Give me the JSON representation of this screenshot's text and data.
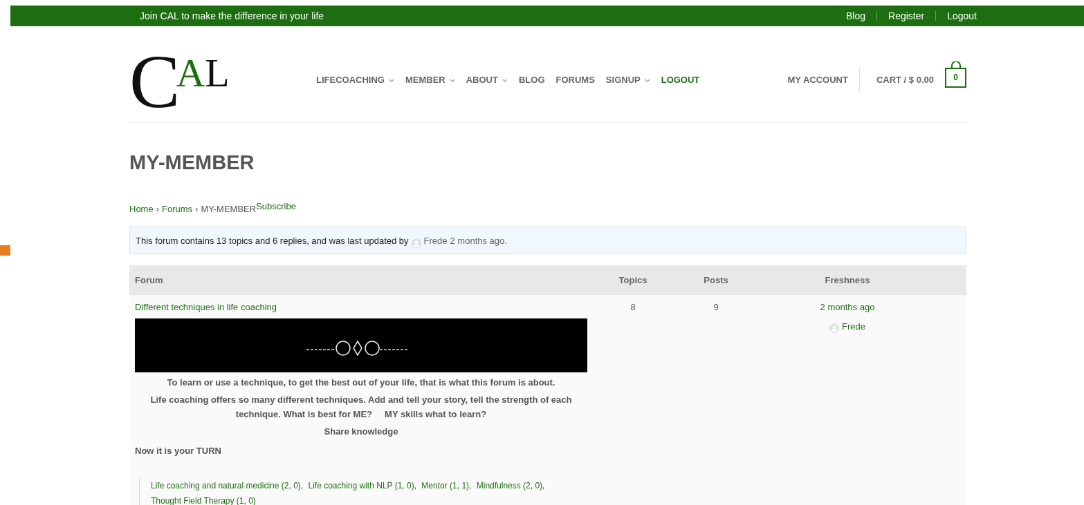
{
  "top_bar": {
    "tagline": "Join CAL to make the difference in your life",
    "links": [
      "Blog",
      "Register",
      "Logout"
    ]
  },
  "logo": {
    "letters": [
      {
        "text": "C",
        "color": "#111111"
      },
      {
        "text": "A",
        "color": "#1c6e10"
      },
      {
        "text": "L",
        "color": "#111111"
      }
    ]
  },
  "nav": [
    {
      "label": "LIFECOACHING",
      "dropdown": true,
      "selected": false
    },
    {
      "label": "MEMBER",
      "dropdown": true,
      "selected": false
    },
    {
      "label": "ABOUT",
      "dropdown": true,
      "selected": false
    },
    {
      "label": "BLOG",
      "dropdown": false,
      "selected": false
    },
    {
      "label": "FORUMS",
      "dropdown": false,
      "selected": false
    },
    {
      "label": "SIGNUP",
      "dropdown": true,
      "selected": false
    },
    {
      "label": "LOGOUT",
      "dropdown": false,
      "selected": true
    }
  ],
  "account": {
    "my_account": "MY ACCOUNT",
    "cart": "CART / $ 0.00",
    "cart_count": "0"
  },
  "page_title": "MY-MEMBER",
  "breadcrumb": {
    "links": [
      "Home",
      "Forums"
    ],
    "separator": "›",
    "current": "MY-MEMBER",
    "subscribe": "Subscribe"
  },
  "notice": {
    "text": "This forum contains 13 topics and 6 replies, and was last updated by",
    "user": "Frede",
    "time": "2 months ago."
  },
  "table": {
    "columns": [
      "Forum",
      "Topics",
      "Posts",
      "Freshness"
    ],
    "rows": [
      {
        "title": "Different techniques in life coaching",
        "topics": "8",
        "posts": "9",
        "freshness": "2 months ago",
        "author": "Frede",
        "description": [
          "To learn or use a technique, to get the best out of your life, that is what this forum is about.",
          "Life coaching offers so many different techniques. Add and tell your story, tell the strength of each technique. What is best for ME?     MY skills what to learn?",
          "Share knowledge"
        ],
        "note": "Now it is your TURN",
        "subforums": [
          "Life coaching and natural medicine (2, 0),",
          "Life coaching with NLP (1, 0),",
          "Mentor (1, 1),",
          "Mindfulness (2, 0),",
          "Thought Field Therapy (1, 0)"
        ]
      }
    ]
  }
}
